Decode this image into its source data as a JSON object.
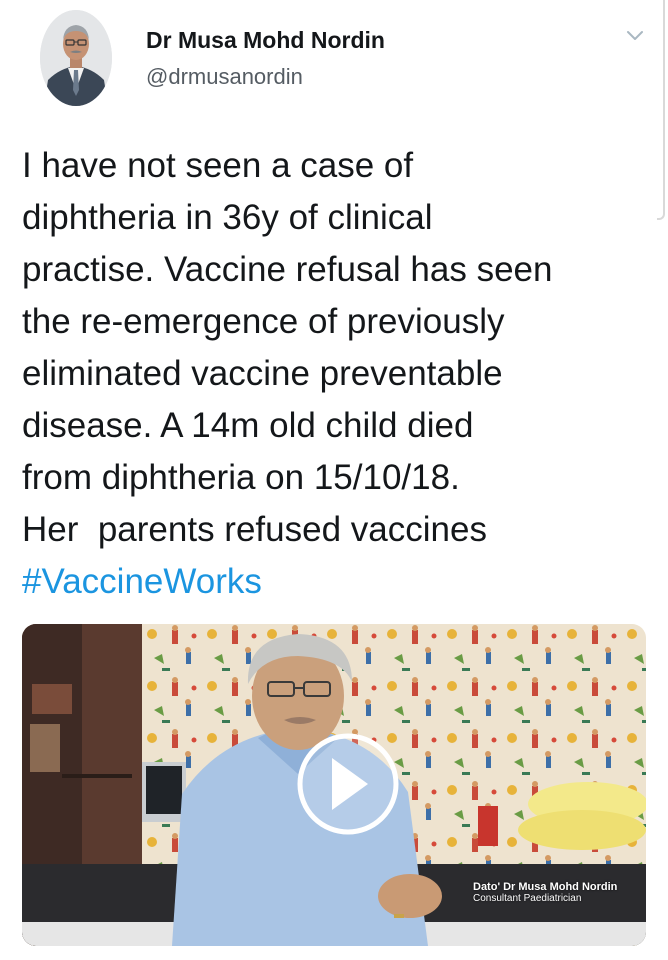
{
  "tweet": {
    "display_name": "Dr Musa Mohd Nordin",
    "handle": "@drmusanordin",
    "body_lines": [
      "I have not seen a case of",
      "diphtheria in 36y of clinical",
      "practise. Vaccine refusal has seen",
      "the re-emergence of previously",
      "eliminated vaccine preventable",
      "disease. A 14m old child died",
      "from diphtheria on 15/10/18.",
      "Her  parents refused vaccines"
    ],
    "hashtag": "#VaccineWorks"
  },
  "media": {
    "caption_name": "Dato' Dr Musa Mohd Nordin",
    "caption_title": "Consultant Paediatrician",
    "play_icon": "play-icon"
  },
  "icons": {
    "caret": "chevron-down-icon"
  },
  "colors": {
    "hashtag": "#1b95e0",
    "text": "#14171a",
    "handle": "#555c63"
  }
}
